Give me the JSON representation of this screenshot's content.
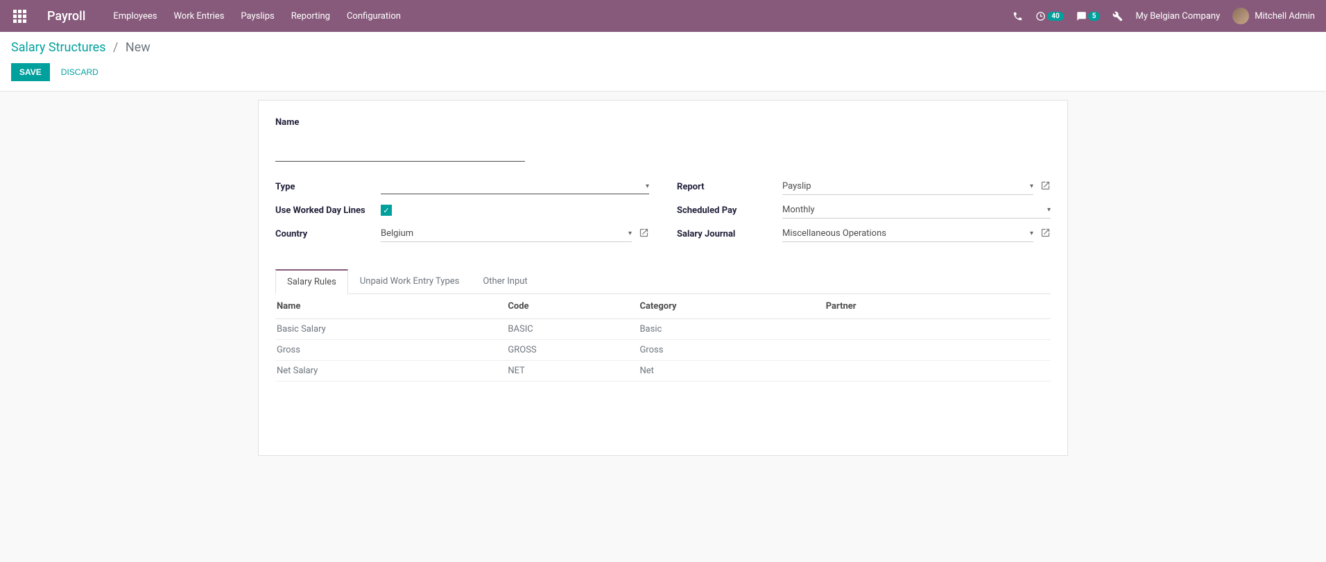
{
  "navbar": {
    "app_title": "Payroll",
    "menu": [
      "Employees",
      "Work Entries",
      "Payslips",
      "Reporting",
      "Configuration"
    ],
    "activities_count": "40",
    "messages_count": "5",
    "company": "My Belgian Company",
    "user": "Mitchell Admin"
  },
  "breadcrumb": {
    "parent": "Salary Structures",
    "current": "New"
  },
  "actions": {
    "save": "SAVE",
    "discard": "DISCARD"
  },
  "form": {
    "name_label": "Name",
    "name_value": "",
    "left": {
      "type_label": "Type",
      "type_value": "",
      "worked_days_label": "Use Worked Day Lines",
      "worked_days_checked": true,
      "country_label": "Country",
      "country_value": "Belgium"
    },
    "right": {
      "report_label": "Report",
      "report_value": "Payslip",
      "scheduled_pay_label": "Scheduled Pay",
      "scheduled_pay_value": "Monthly",
      "salary_journal_label": "Salary Journal",
      "salary_journal_value": "Miscellaneous Operations"
    }
  },
  "tabs": [
    "Salary Rules",
    "Unpaid Work Entry Types",
    "Other Input"
  ],
  "table": {
    "columns": [
      "Name",
      "Code",
      "Category",
      "Partner"
    ],
    "rows": [
      {
        "name": "Basic Salary",
        "code": "BASIC",
        "category": "Basic",
        "partner": ""
      },
      {
        "name": "Gross",
        "code": "GROSS",
        "category": "Gross",
        "partner": ""
      },
      {
        "name": "Net Salary",
        "code": "NET",
        "category": "Net",
        "partner": ""
      }
    ]
  }
}
